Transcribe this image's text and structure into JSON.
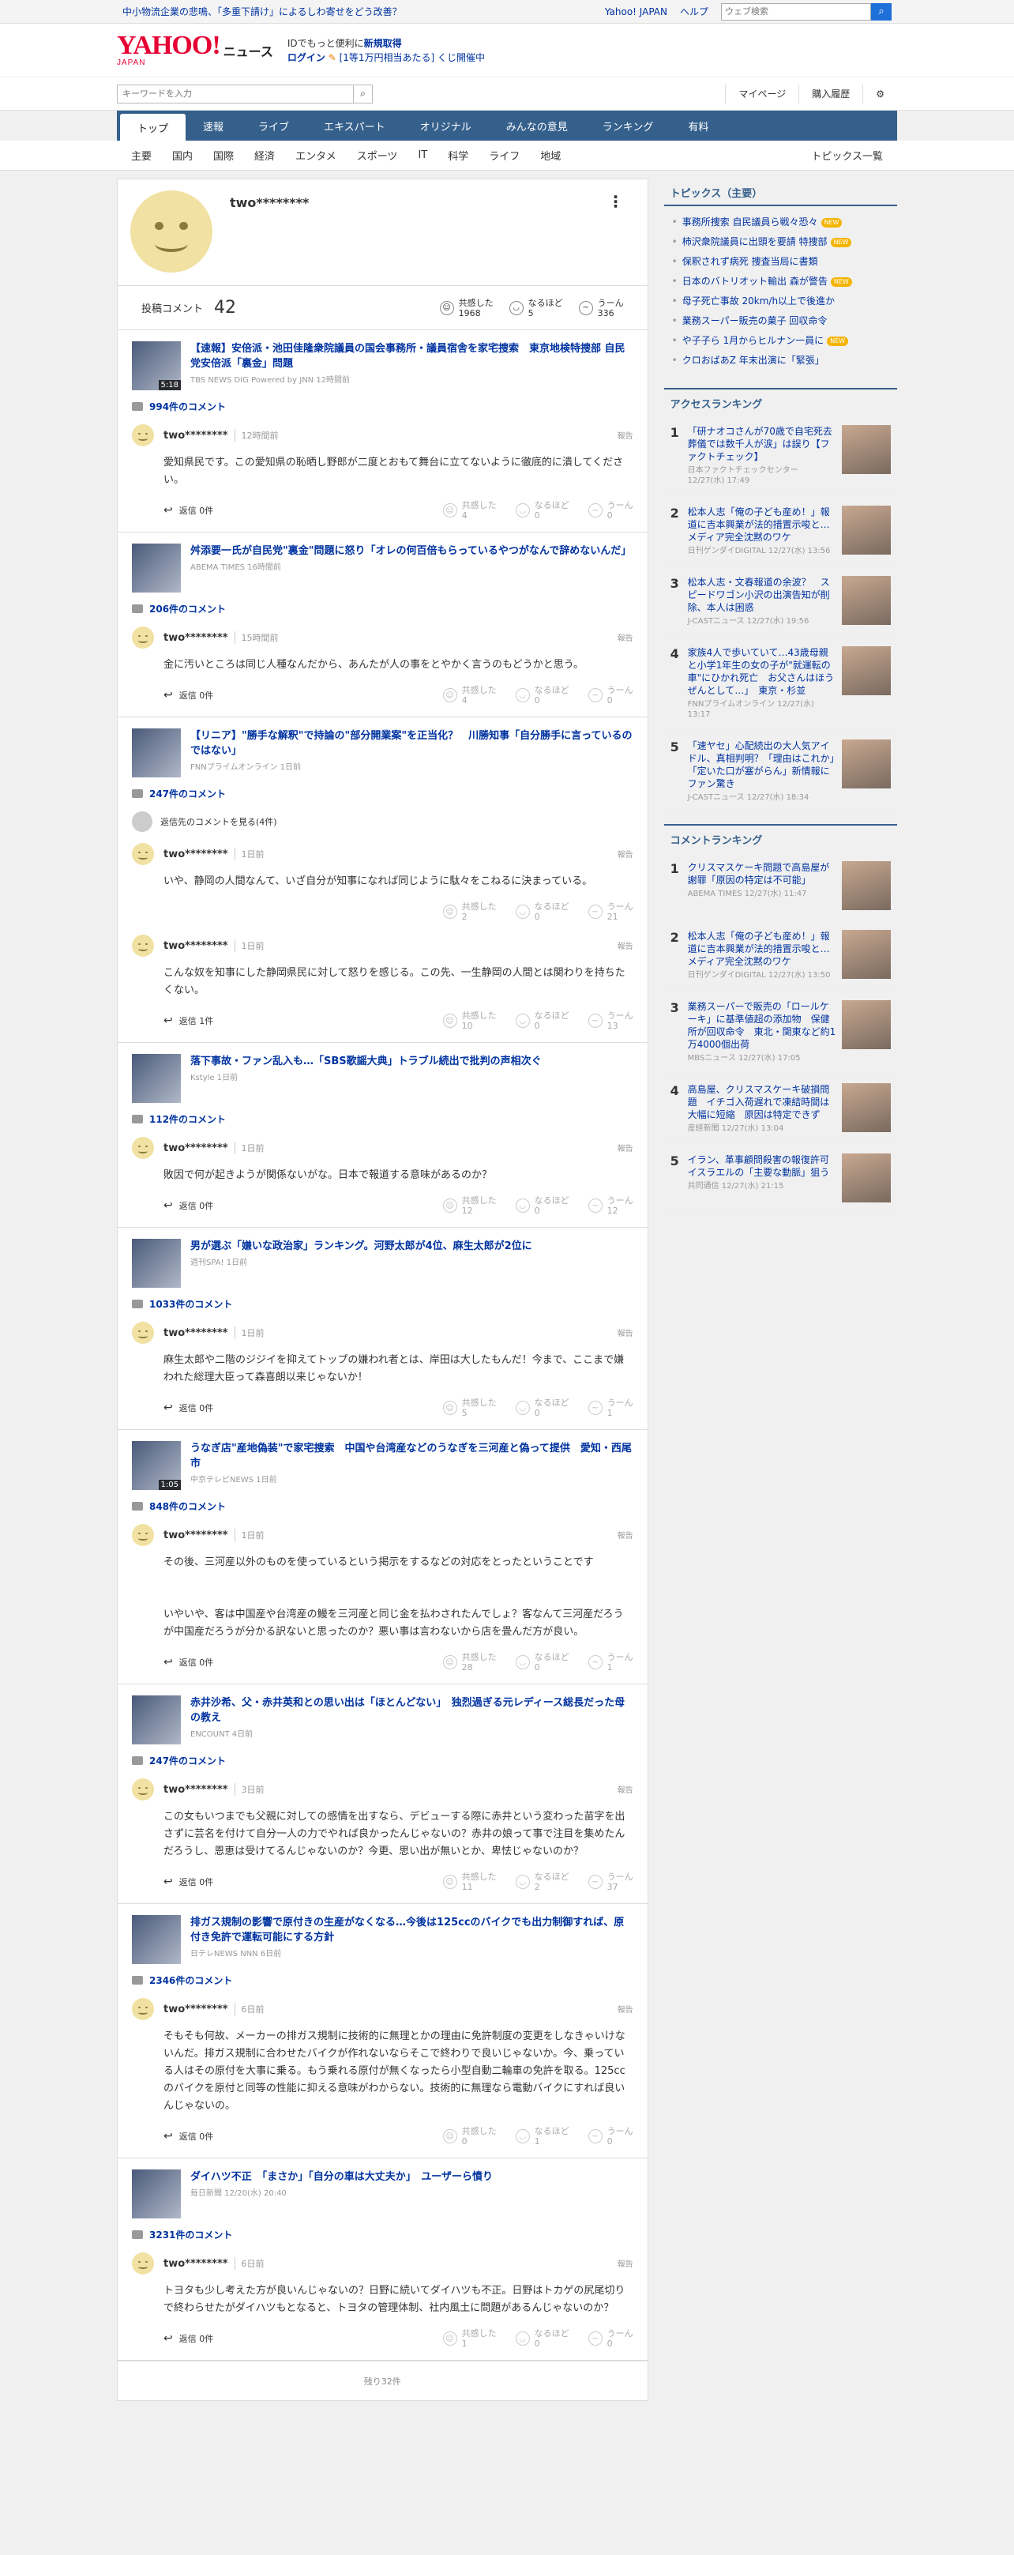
{
  "topbar": {
    "promo": "中小物流企業の悲鳴、「多重下請け」によるしわ寄せをどう改善？",
    "links": [
      "Yahoo! JAPAN",
      "ヘルプ"
    ],
    "search_placeholder": "ウェブ検索"
  },
  "header": {
    "logo": "YAHOO!",
    "logo_sub": "JAPAN",
    "news": "ニュース",
    "line1_pre": "IDでもっと便利に",
    "line1_link": "新規取得",
    "line2_login": "ログイン",
    "line2_rest": "[1等1万円相当あたる] くじ開催中"
  },
  "searchbar": {
    "placeholder": "キーワードを入力",
    "links": [
      "マイページ",
      "購入履歴"
    ]
  },
  "gnav": [
    "トップ",
    "速報",
    "ライブ",
    "エキスパート",
    "オリジナル",
    "みんなの意見",
    "ランキング",
    "有料"
  ],
  "subnav": {
    "items": [
      "主要",
      "国内",
      "国際",
      "経済",
      "エンタメ",
      "スポーツ",
      "IT",
      "科学",
      "ライフ",
      "地域"
    ],
    "right": "トピックス一覧"
  },
  "profile": {
    "name": "two********",
    "comment_label": "投稿コメント",
    "comment_count": "42",
    "reactions": [
      {
        "label": "共感した",
        "count": "1968"
      },
      {
        "label": "なるほど",
        "count": "5"
      },
      {
        "label": "うーん",
        "count": "336"
      }
    ]
  },
  "reaction_labels": [
    "共感した",
    "なるほど",
    "うーん"
  ],
  "items": [
    {
      "title": "【速報】安倍派・池田佳隆衆院議員の国会事務所・議員宿舎を家宅捜索　東京地検特捜部 自民党安倍派「裏金」問題",
      "source": "TBS NEWS DIG Powered by JNN 12時間前",
      "duration": "5:18",
      "ccount": "994件のコメント",
      "comments": [
        {
          "user": "two********",
          "time": "12時間前",
          "text": "愛知県民です。この愛知県の恥晒し野郎が二度とおもて舞台に立てないように徹底的に潰してください。",
          "reply": "返信 0件",
          "counts": [
            "4",
            "0",
            "0"
          ]
        }
      ]
    },
    {
      "title": "舛添要一氏が自民党\"裏金\"問題に怒り「オレの何百倍もらっているやつがなんで辞めないんだ」",
      "source": "ABEMA TIMES 16時間前",
      "ccount": "206件のコメント",
      "comments": [
        {
          "user": "two********",
          "time": "15時間前",
          "text": "金に汚いところは同じ人種なんだから、あんたが人の事をとやかく言うのもどうかと思う。",
          "reply": "返信 0件",
          "counts": [
            "4",
            "0",
            "0"
          ]
        }
      ]
    },
    {
      "title": "【リニア】\"勝手な解釈\"で持論の\"部分開業案\"を正当化？　川勝知事「自分勝手に言っているのではない」",
      "source": "FNNプライムオンライン 1日前",
      "ccount": "247件のコメント",
      "reply_prev": "返信先のコメントを見る(4件)",
      "comments": [
        {
          "user": "two********",
          "time": "1日前",
          "text": "いや、静岡の人間なんて、いざ自分が知事になれば同じように駄々をこねるに決まっている。",
          "reply": "",
          "counts": [
            "2",
            "0",
            "21"
          ]
        },
        {
          "user": "two********",
          "time": "1日前",
          "text": "こんな奴を知事にした静岡県民に対して怒りを感じる。この先、一生静岡の人間とは関わりを持ちたくない。",
          "reply": "返信 1件",
          "counts": [
            "10",
            "0",
            "13"
          ]
        }
      ]
    },
    {
      "title": "落下事故・ファン乱入も…「SBS歌謡大典」トラブル続出で批判の声相次ぐ",
      "source": "Kstyle 1日前",
      "ccount": "112件のコメント",
      "comments": [
        {
          "user": "two********",
          "time": "1日前",
          "text": "敗因で何が起きようが関係ないがな。日本で報道する意味があるのか？",
          "reply": "返信 0件",
          "counts": [
            "12",
            "0",
            "12"
          ]
        }
      ]
    },
    {
      "title": "男が選ぶ「嫌いな政治家」ランキング。河野太郎が4位、麻生太郎が2位に",
      "source": "週刊SPA! 1日前",
      "ccount": "1033件のコメント",
      "comments": [
        {
          "user": "two********",
          "time": "1日前",
          "text": "麻生太郎や二階のジジイを抑えてトップの嫌われ者とは、岸田は大したもんだ！今まで、ここまで嫌われた総理大臣って森喜朗以来じゃないか！",
          "reply": "返信 0件",
          "counts": [
            "5",
            "0",
            "1"
          ]
        }
      ]
    },
    {
      "title": "うなぎ店\"産地偽装\"で家宅捜索　中国や台湾産などのうなぎを三河産と偽って提供　愛知・西尾市",
      "source": "中京テレビNEWS 1日前",
      "duration": "1:05",
      "ccount": "848件のコメント",
      "comments": [
        {
          "user": "two********",
          "time": "1日前",
          "text": "その後、三河産以外のものを使っているという掲示をするなどの対応をとったということです\n\n\nいやいや、客は中国産や台湾産の鰻を三河産と同じ金を払わされたんでしょ？客なんて三河産だろうが中国産だろうが分かる訳ないと思ったのか？悪い事は言わないから店を畳んだ方が良い。",
          "reply": "返信 0件",
          "counts": [
            "28",
            "0",
            "1"
          ]
        }
      ]
    },
    {
      "title": "赤井沙希、父・赤井英和との思い出は「ほとんどない」　独烈過ぎる元レディース総長だった母の教え",
      "source": "ENCOUNT 4日前",
      "ccount": "247件のコメント",
      "comments": [
        {
          "user": "two********",
          "time": "3日前",
          "text": "この女もいつまでも父親に対しての感情を出すなら、デビューする際に赤井という変わった苗字を出さずに芸名を付けて自分一人の力でやれば良かったんじゃないの？赤井の娘って事で注目を集めたんだろうし、恩恵は受けてるんじゃないのか？今更、思い出が無いとか、卑怯じゃないのか？",
          "reply": "返信 0件",
          "counts": [
            "11",
            "2",
            "37"
          ]
        }
      ]
    },
    {
      "title": "排ガス規制の影響で原付きの生産がなくなる…今後は125ccのバイクでも出力制御すれば、原付き免許で運転可能にする方針",
      "source": "日テレNEWS NNN 6日前",
      "ccount": "2346件のコメント",
      "comments": [
        {
          "user": "two********",
          "time": "6日前",
          "text": "そもそも何故、メーカーの排ガス規制に技術的に無理とかの理由に免許制度の変更をしなきゃいけないんだ。排ガス規制に合わせたバイクが作れないならそこで終わりで良いじゃないか。今、乗っている人はその原付を大事に乗る。もう乗れる原付が無くなったら小型自動二輪車の免許を取る。125ccのバイクを原付と同等の性能に抑える意味がわからない。技術的に無理なら電動バイクにすれば良いんじゃないの。",
          "reply": "返信 0件",
          "counts": [
            "0",
            "1",
            "0"
          ]
        }
      ]
    },
    {
      "title": "ダイハツ不正　「まさか」「自分の車は大丈夫か」　ユーザーら憤り",
      "source": "毎日新聞 12/20(水) 20:40",
      "ccount": "3231件のコメント",
      "comments": [
        {
          "user": "two********",
          "time": "6日前",
          "text": "トヨタも少し考えた方が良いんじゃないの？日野に続いてダイハツも不正。日野はトカゲの尻尾切りで終わらせたがダイハツもとなると、トヨタの管理体制、社内風土に問題があるんじゃないのか？",
          "reply": "返信 0件",
          "counts": [
            "1",
            "0",
            "0"
          ]
        }
      ]
    }
  ],
  "rest": "残り32件",
  "sidebar": {
    "topics_title": "トピックス（主要）",
    "topics": [
      {
        "t": "事務所捜索 自民議員ら戦々恐々",
        "new": true
      },
      {
        "t": "柿沢衆院議員に出頭を要請 特捜部",
        "new": true
      },
      {
        "t": "保釈されず病死 捜査当局に書類",
        "new": false
      },
      {
        "t": "日本のバトリオット輸出 森が警告",
        "new": true
      },
      {
        "t": "母子死亡事故 20km/h以上で後進か",
        "new": false
      },
      {
        "t": "業務スーパー販売の菓子 回収命令",
        "new": false
      },
      {
        "t": "や子子ら 1月からヒルナン一員に",
        "new": true
      },
      {
        "t": "クロおばあZ 年末出演に「緊張」",
        "new": false
      }
    ],
    "new_label": "NEW",
    "access_title": "アクセスランキング",
    "access": [
      {
        "t": "「研ナオコさんが70歳で自宅死去 葬儀では数千人が涙」は誤り【ファクトチェック】",
        "m": "日本ファクトチェックセンター 12/27(水) 17:49"
      },
      {
        "t": "松本人志「俺の子ども産め！」報道に吉本興業が法的措置示唆と…メディア完全沈黙のワケ",
        "m": "日刊ゲンダイDIGITAL 12/27(水) 13:56"
      },
      {
        "t": "松本人志・文春報道の余波？　スピードワゴン小沢の出演告知が削除、本人は困惑",
        "m": "J-CASTニュース 12/27(水) 19:56"
      },
      {
        "t": "家族4人で歩いていて…43歳母親と小学1年生の女の子が\"就運転の車\"にひかれ死亡　お父さんはほうぜんとして…」　東京・杉並",
        "m": "FNNプライムオンライン 12/27(水) 13:17"
      },
      {
        "t": "「速ヤセ」心配続出の大人気アイドル、真相判明？「理由はこれか」「定いた口が塞がらん」新情報にファン驚き",
        "m": "J-CASTニュース 12/27(水) 18:34"
      }
    ],
    "comment_title": "コメントランキング",
    "comment_rank": [
      {
        "t": "クリスマスケーキ問題で高島屋が謝罪「原因の特定は不可能」",
        "m": "ABEMA TIMES 12/27(水) 11:47"
      },
      {
        "t": "松本人志「俺の子ども産め！」報道に吉本興業が法的措置示唆と…メディア完全沈黙のワケ",
        "m": "日刊ゲンダイDIGITAL 12/27(水) 13:50"
      },
      {
        "t": "業務スーパーで販売の「ロールケーキ」に基準値超の添加物　保健所が回収命令　東北・関東など約1万4000個出荷",
        "m": "MBSニュース 12/27(水) 17:05"
      },
      {
        "t": "高島屋、クリスマスケーキ破損問題　イチゴ入荷遅れで凍結時間は大幅に短縮　原因は特定できず",
        "m": "産経新聞 12/27(水) 13:04"
      },
      {
        "t": "イラン、革事顧問殺害の報復許可 イスラエルの「主要な動脈」狙う",
        "m": "共同通信 12/27(水) 21:15"
      }
    ]
  }
}
